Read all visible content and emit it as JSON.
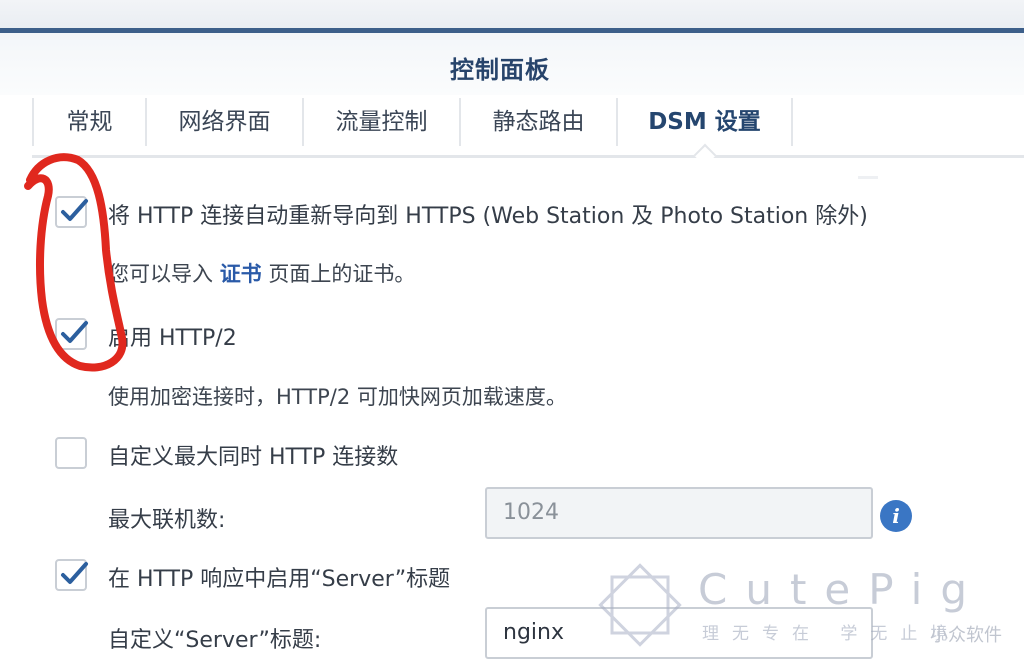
{
  "window": {
    "title": "控制面板"
  },
  "tabs": [
    {
      "label": "常规",
      "active": false
    },
    {
      "label": "网络界面",
      "active": false
    },
    {
      "label": "流量控制",
      "active": false
    },
    {
      "label": "静态路由",
      "active": false
    },
    {
      "label": "DSM 设置",
      "active": true
    }
  ],
  "options": {
    "https_redirect": {
      "label": "将 HTTP 连接自动重新导向到 HTTPS (Web Station 及 Photo Station 除外)",
      "checked": true,
      "hint_pre": "您可以导入",
      "hint_link": "证书",
      "hint_post": "页面上的证书。"
    },
    "http2": {
      "label": "启用 HTTP/2",
      "checked": true,
      "hint": "使用加密连接时，HTTP/2 可加快网页加载速度。"
    },
    "max_connections": {
      "label": "自定义最大同时 HTTP 连接数",
      "checked": false,
      "field_label": "最大联机数:",
      "field_value": "1024",
      "info_glyph": "i"
    },
    "server_header": {
      "label": "在 HTTP 响应中启用“Server”标题",
      "checked": true,
      "field_label": "自定义“Server”标题:",
      "field_value": "nginx"
    }
  },
  "watermark": {
    "title": "CutePig",
    "subtitle": "理无专在 学无止境",
    "source": "小众软件"
  },
  "colors": {
    "accent": "#27446b",
    "check": "#2c5f9e",
    "scribble": "#e0281e",
    "link": "#2a5aa8"
  }
}
